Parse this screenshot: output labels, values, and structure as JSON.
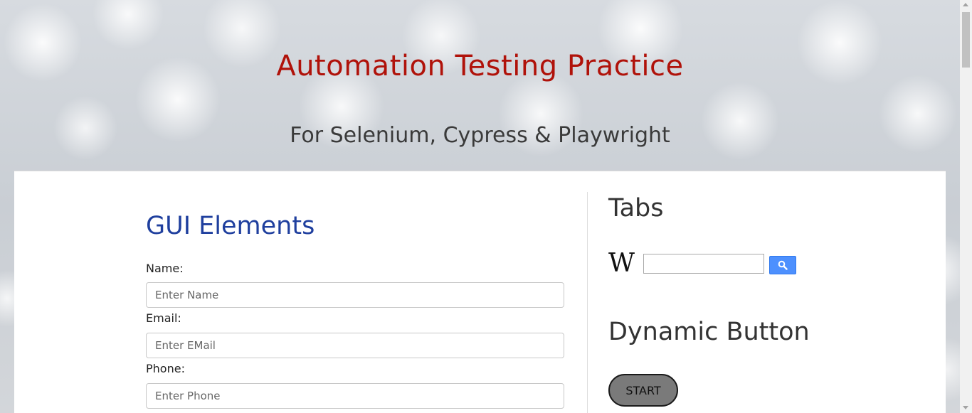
{
  "header": {
    "title": "Automation Testing Practice",
    "subtitle": "For Selenium, Cypress & Playwright"
  },
  "gui_section": {
    "title": "GUI Elements",
    "fields": [
      {
        "label": "Name:",
        "placeholder": "Enter Name",
        "value": ""
      },
      {
        "label": "Email:",
        "placeholder": "Enter EMail",
        "value": ""
      },
      {
        "label": "Phone:",
        "placeholder": "Enter Phone",
        "value": ""
      }
    ]
  },
  "tabs_section": {
    "title": "Tabs",
    "wiki_logo": "W",
    "search_value": "",
    "search_icon": "search-icon"
  },
  "dynamic_section": {
    "title": "Dynamic Button",
    "button_label": "START"
  },
  "colors": {
    "title": "#b0120a",
    "section_heading": "#1f3f9e",
    "search_button": "#4d90fe",
    "start_button": "#7a7a7a"
  }
}
